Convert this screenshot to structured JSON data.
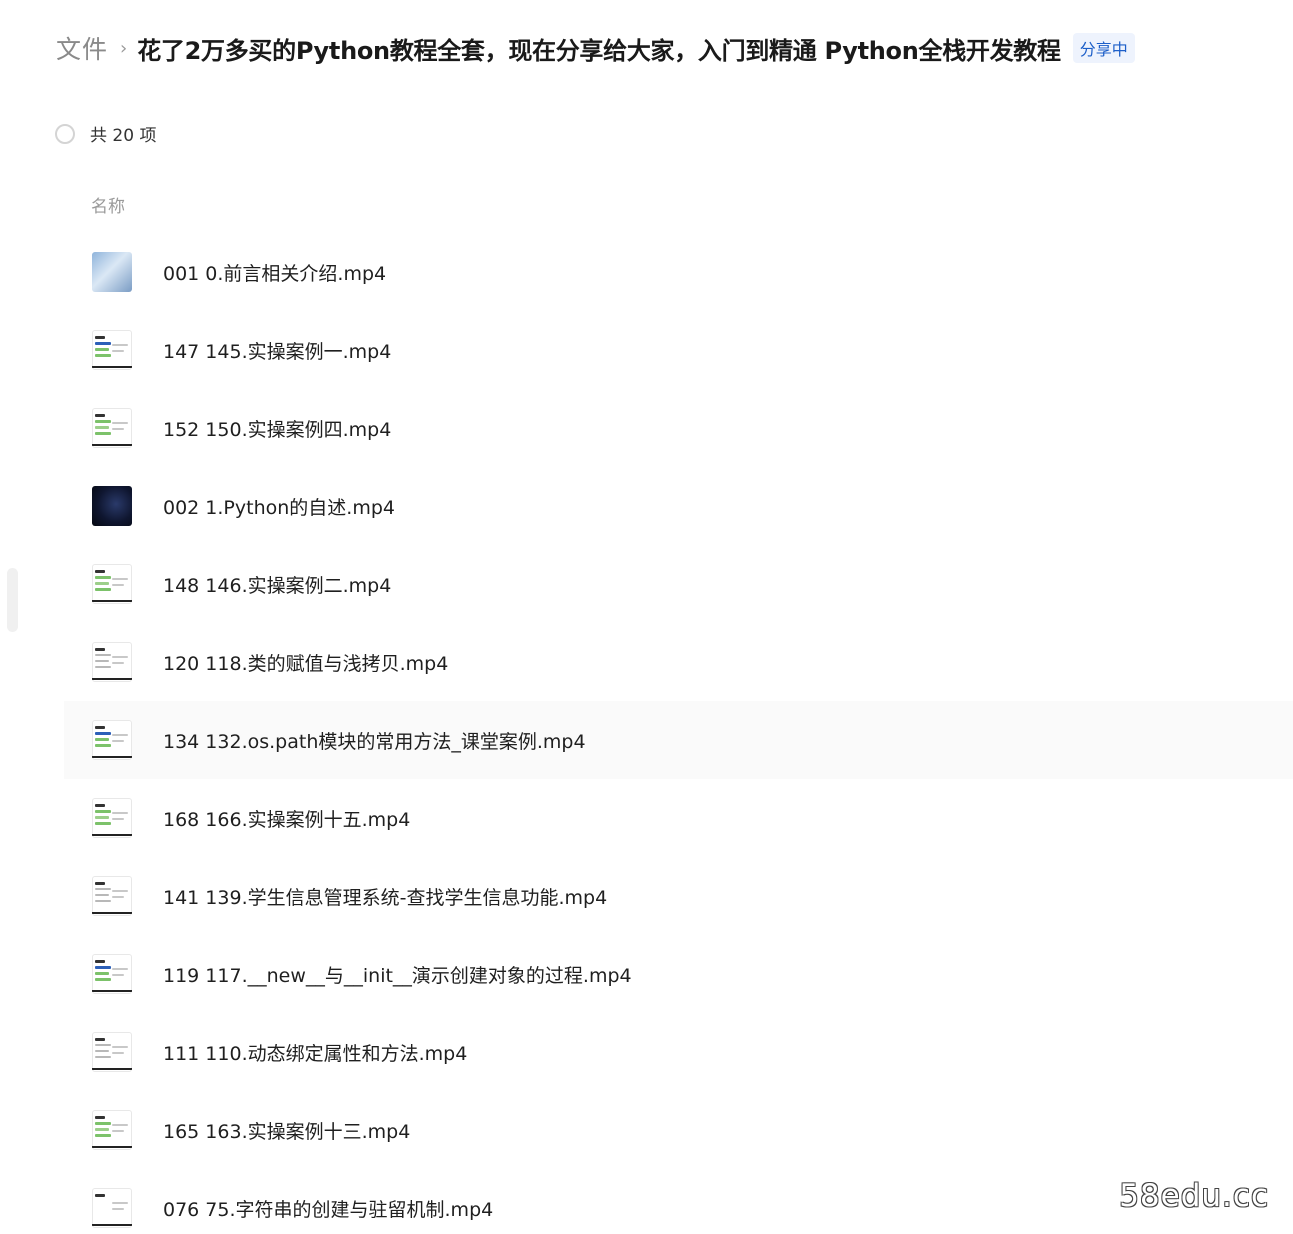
{
  "breadcrumb": {
    "root": "文件",
    "separator": "›",
    "current": "花了2万多买的Python教程全套，现在分享给大家，入门到精通 Python全栈开发教程",
    "badge": "分享中"
  },
  "selection": {
    "count_text": "共 20 项"
  },
  "list_header": {
    "name_column": "名称"
  },
  "files": [
    {
      "name": "001 0.前言相关介绍.mp4",
      "thumb": "sky"
    },
    {
      "name": "147 145.实操案例一.mp4",
      "thumb": "blue"
    },
    {
      "name": "152 150.实操案例四.mp4",
      "thumb": "green"
    },
    {
      "name": "002 1.Python的自述.mp4",
      "thumb": "dark"
    },
    {
      "name": "148 146.实操案例二.mp4",
      "thumb": "green"
    },
    {
      "name": "120 118.类的赋值与浅拷贝.mp4",
      "thumb": "text"
    },
    {
      "name": "134 132.os.path模块的常用方法_课堂案例.mp4",
      "thumb": "blue"
    },
    {
      "name": "168 166.实操案例十五.mp4",
      "thumb": "green"
    },
    {
      "name": "141 139.学生信息管理系统-查找学生信息功能.mp4",
      "thumb": "text"
    },
    {
      "name": "119 117.__new__与__init__演示创建对象的过程.mp4",
      "thumb": "blue"
    },
    {
      "name": "111 110.动态绑定属性和方法.mp4",
      "thumb": "text"
    },
    {
      "name": "165 163.实操案例十三.mp4",
      "thumb": "green"
    },
    {
      "name": "076 75.字符串的创建与驻留机制.mp4",
      "thumb": "text"
    }
  ],
  "watermark": "58edu.cc"
}
